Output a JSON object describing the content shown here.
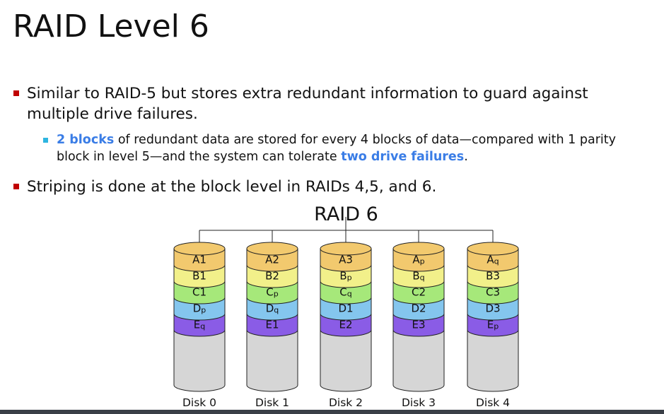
{
  "slide": {
    "title": "RAID Level 6"
  },
  "bullets": [
    {
      "line1": "Similar to RAID-5 but stores extra redundant information to guard against",
      "line2": "multiple drive failures."
    },
    {
      "line1": "Striping is done at the block level in RAIDs 4,5, and 6."
    }
  ],
  "sub_bullet": {
    "part1_hl": "2 blocks",
    "part1_rest": " of redundant data are stored for every 4 blocks of data—compared with 1 parity",
    "part2_pre": "block in level 5—and the system can tolerate ",
    "part2_hl": "two drive failures",
    "part2_post": "."
  },
  "diagram": {
    "title": "RAID 6",
    "disks": [
      {
        "label": "Disk 0",
        "blocks": [
          {
            "b": "A",
            "s": "1"
          },
          {
            "b": "B",
            "s": "1"
          },
          {
            "b": "C",
            "s": "1"
          },
          {
            "b": "D",
            "s": "p"
          },
          {
            "b": "E",
            "s": "q"
          }
        ]
      },
      {
        "label": "Disk 1",
        "blocks": [
          {
            "b": "A",
            "s": "2"
          },
          {
            "b": "B",
            "s": "2"
          },
          {
            "b": "C",
            "s": "p"
          },
          {
            "b": "D",
            "s": "q"
          },
          {
            "b": "E",
            "s": "1"
          }
        ]
      },
      {
        "label": "Disk 2",
        "blocks": [
          {
            "b": "A",
            "s": "3"
          },
          {
            "b": "B",
            "s": "p"
          },
          {
            "b": "C",
            "s": "q"
          },
          {
            "b": "D",
            "s": "1"
          },
          {
            "b": "E",
            "s": "2"
          }
        ]
      },
      {
        "label": "Disk 3",
        "blocks": [
          {
            "b": "A",
            "s": "p"
          },
          {
            "b": "B",
            "s": "q"
          },
          {
            "b": "C",
            "s": "2"
          },
          {
            "b": "D",
            "s": "2"
          },
          {
            "b": "E",
            "s": "3"
          }
        ]
      },
      {
        "label": "Disk 4",
        "blocks": [
          {
            "b": "A",
            "s": "q"
          },
          {
            "b": "B",
            "s": "3"
          },
          {
            "b": "C",
            "s": "3"
          },
          {
            "b": "D",
            "s": "3"
          },
          {
            "b": "E",
            "s": "p"
          }
        ]
      }
    ],
    "row_colors": [
      "#f2c96e",
      "#f2f08a",
      "#a6e87a",
      "#84c6ee",
      "#8a5ce6"
    ],
    "body_color": "#d6d6d6"
  }
}
